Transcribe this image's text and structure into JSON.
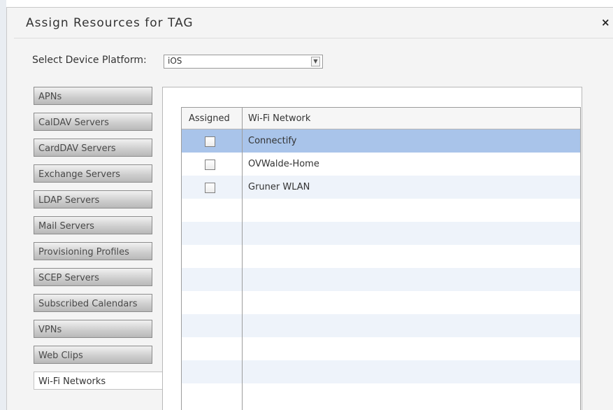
{
  "dialog": {
    "title": "Assign Resources for TAG",
    "close_glyph": "×"
  },
  "platform": {
    "label": "Select Device Platform:",
    "selected": "iOS",
    "arrow_glyph": "▼"
  },
  "tabs": [
    {
      "label": "APNs",
      "active": false
    },
    {
      "label": "CalDAV Servers",
      "active": false
    },
    {
      "label": "CardDAV Servers",
      "active": false
    },
    {
      "label": "Exchange Servers",
      "active": false
    },
    {
      "label": "LDAP Servers",
      "active": false
    },
    {
      "label": "Mail Servers",
      "active": false
    },
    {
      "label": "Provisioning Profiles",
      "active": false
    },
    {
      "label": "SCEP Servers",
      "active": false
    },
    {
      "label": "Subscribed Calendars",
      "active": false
    },
    {
      "label": "VPNs",
      "active": false
    },
    {
      "label": "Web Clips",
      "active": false
    },
    {
      "label": "Wi-Fi Networks",
      "active": true
    }
  ],
  "grid": {
    "columns": [
      "Assigned",
      "Wi-Fi Network"
    ],
    "rows": [
      {
        "assigned": false,
        "name": "Connectify",
        "selected": true
      },
      {
        "assigned": false,
        "name": "OVWalde-Home",
        "selected": false
      },
      {
        "assigned": false,
        "name": "Gruner WLAN",
        "selected": false
      }
    ]
  },
  "colors": {
    "selected_row": "#a9c4ea",
    "alt_row": "#eef3fa",
    "tab_gradient_dark": "#b8b8b8"
  },
  "icons": {
    "close": "close-icon",
    "dropdown": "chevron-down-icon"
  }
}
